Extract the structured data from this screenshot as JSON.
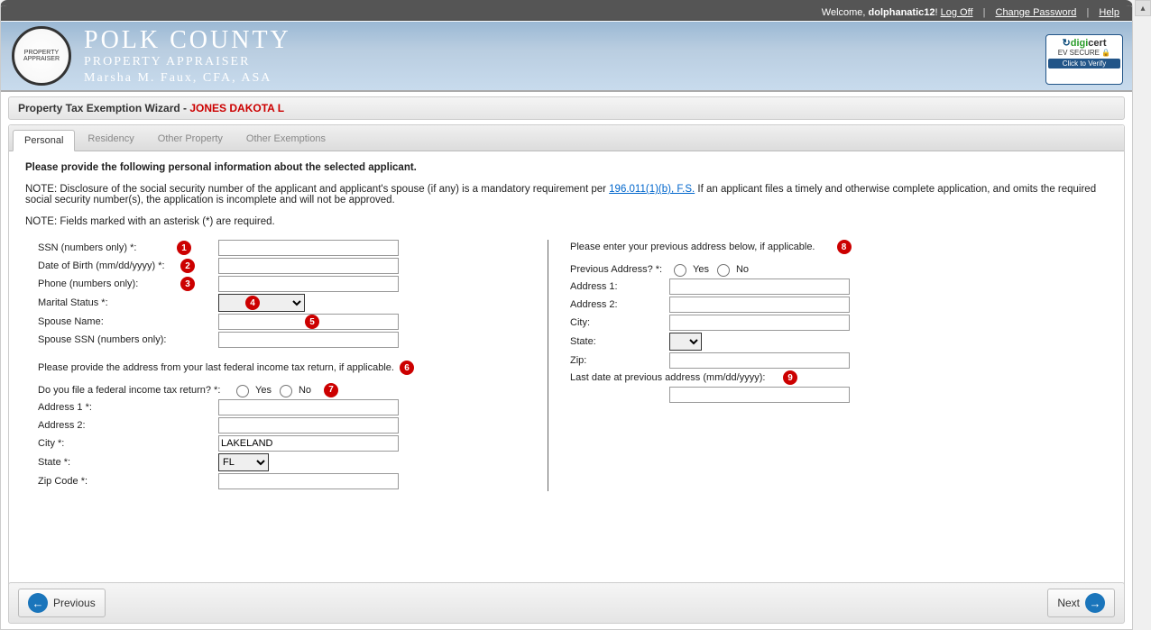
{
  "topbar": {
    "welcome_prefix": "Welcome, ",
    "username": "dolphanatic12",
    "welcome_suffix": "!",
    "logoff": "Log Off",
    "change_password": "Change Password",
    "help": "Help"
  },
  "banner": {
    "line1": "POLK COUNTY",
    "line2": "PROPERTY APPRAISER",
    "line3": "Marsha M. Faux, CFA, ASA"
  },
  "digicert": {
    "brand_prefix": "digi",
    "brand_suffix": "cert",
    "line2": "EV SECURE",
    "line3": "Click to Verify"
  },
  "wizard": {
    "title_prefix": "Property Tax Exemption Wizard - ",
    "applicant": "JONES DAKOTA L"
  },
  "tabs": [
    {
      "label": "Personal",
      "active": true
    },
    {
      "label": "Residency",
      "active": false
    },
    {
      "label": "Other Property",
      "active": false
    },
    {
      "label": "Other Exemptions",
      "active": false
    }
  ],
  "body": {
    "heading": "Please provide the following personal information about the selected applicant.",
    "note1_prefix": "NOTE: Disclosure of the social security number of the applicant and applicant's spouse (if any) is a mandatory requirement per ",
    "statute_link": "196.011(1)(b), F.S.",
    "note1_suffix": " If an applicant files a timely and otherwise complete application, and omits the required social security number(s), the application is incomplete and will not be approved.",
    "note2": "NOTE: Fields marked with an asterisk (*) are required."
  },
  "left": {
    "ssn_label": "SSN (numbers only) *:",
    "dob_label": "Date of Birth (mm/dd/yyyy) *:",
    "phone_label": "Phone (numbers only):",
    "marital_label": "Marital Status *:",
    "spouse_name_label": "Spouse Name:",
    "spouse_ssn_label": "Spouse SSN (numbers only):",
    "tax_instr": "Please provide the address from your last federal income tax return, if applicable.",
    "tax_file_label": "Do you file a federal income tax return? *:",
    "yes": "Yes",
    "no": "No",
    "addr1_label": "Address 1 *:",
    "addr2_label": "Address 2:",
    "city_label": "City *:",
    "city_value": "LAKELAND",
    "state_label": "State *:",
    "state_value": "FL",
    "zip_label": "Zip Code *:"
  },
  "right": {
    "instr": "Please enter your previous address below, if applicable.",
    "prev_addr_q": "Previous Address? *:",
    "yes": "Yes",
    "no": "No",
    "addr1_label": "Address 1:",
    "addr2_label": "Address 2:",
    "city_label": "City:",
    "state_label": "State:",
    "zip_label": "Zip:",
    "last_date_label": "Last date at previous address (mm/dd/yyyy):"
  },
  "markers": {
    "1": "1",
    "2": "2",
    "3": "3",
    "4": "4",
    "5": "5",
    "6": "6",
    "7": "7",
    "8": "8",
    "9": "9"
  },
  "nav": {
    "previous": "Previous",
    "next": "Next"
  }
}
